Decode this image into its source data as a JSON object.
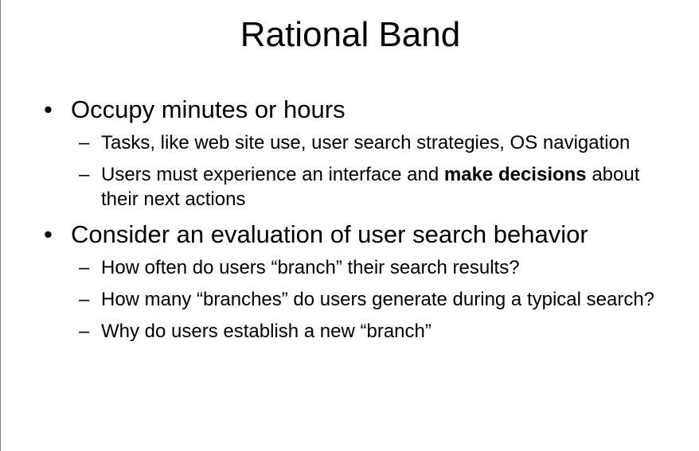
{
  "slide": {
    "title": "Rational Band",
    "bullets": [
      {
        "text": "Occupy minutes or hours",
        "subs": [
          {
            "text": "Tasks, like web site use, user search strategies, OS navigation"
          },
          {
            "before": "Users must experience an interface and ",
            "bold": "make decisions",
            "after": " about their next actions"
          }
        ]
      },
      {
        "text": "Consider an evaluation of user search behavior",
        "subs": [
          {
            "text": "How often do users “branch” their search results?"
          },
          {
            "text": "How many “branches” do users generate during a typical search?"
          },
          {
            "text": "Why do users establish a new “branch”"
          }
        ]
      }
    ],
    "bullet_symbol": "•",
    "sub_bullet_symbol": "–"
  }
}
